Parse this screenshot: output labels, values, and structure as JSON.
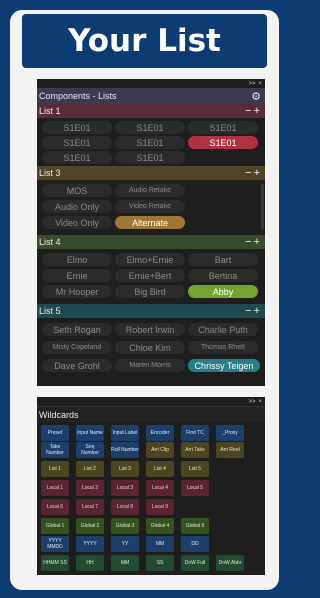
{
  "title": "Your List",
  "panel": {
    "title": "Components - Lists",
    "top_controls": [
      ">>",
      "×"
    ],
    "gear_icon": "gear-icon"
  },
  "lists": [
    {
      "name": "List 1",
      "color": "#5b2c37",
      "items": [
        "S1E01",
        "S1E01",
        "S1E01",
        "S1E01",
        "S1E01",
        "S1E01",
        "S1E01",
        "S1E01"
      ],
      "selected": "S1E01"
    },
    {
      "name": "List 3",
      "color": "#504429",
      "items": [
        "MOS",
        "Audio Retake",
        "Audio Only",
        "Video Retake",
        "Video Only",
        "Alternate"
      ],
      "selected": "Alternate"
    },
    {
      "name": "List 4",
      "color": "#3a4a2c",
      "items": [
        "Elmo",
        "Elmo+Ernie",
        "Bart",
        "Ernie",
        "Ernie+Bert",
        "Bertina",
        "Mr Hooper",
        "Big Bird",
        "Abby"
      ],
      "selected": "Abby"
    },
    {
      "name": "List 5",
      "color": "#1f4a4f",
      "items": [
        "Seth Rogan",
        "Robert Irwin",
        "Charlie Puth",
        "Misty Copeland",
        "Chloe Kim",
        "Thomas Rhett",
        "Dave Grohl",
        "Maren Morris",
        "Chrissy Teigen"
      ],
      "selected": "Chrissy Teigen"
    }
  ],
  "list_controls": {
    "minus": "−",
    "plus": "+"
  },
  "wildcards": {
    "title": "Wildcards",
    "top_controls": [
      ">>",
      "×"
    ],
    "rows": [
      [
        "Preset",
        "Take Number",
        "Input Name",
        "Seq Number",
        "Input Label",
        "Roll Number",
        "Encoder",
        "Arri Clip",
        "First TC",
        "Arri Take",
        "_Proxy",
        "Arri Reel"
      ],
      [
        "List 1",
        "List 2",
        "List 3",
        "List 4",
        "List 5"
      ],
      [
        "Local 1",
        "Local 2",
        "Local 3",
        "Local 4",
        "Local 5"
      ],
      [
        "Local 6",
        "Local 7",
        "Local 8",
        "Local 9"
      ],
      [
        "Global 1",
        "Global 2",
        "Global 3",
        "Global 4",
        "Global 5"
      ],
      [
        "YYYY MMDD",
        "YYYY",
        "YY",
        "MM",
        "DD"
      ],
      [
        "HHMM SS",
        "HH",
        "MM",
        "SS",
        "DoW Full",
        "DoW Abbr"
      ]
    ]
  }
}
